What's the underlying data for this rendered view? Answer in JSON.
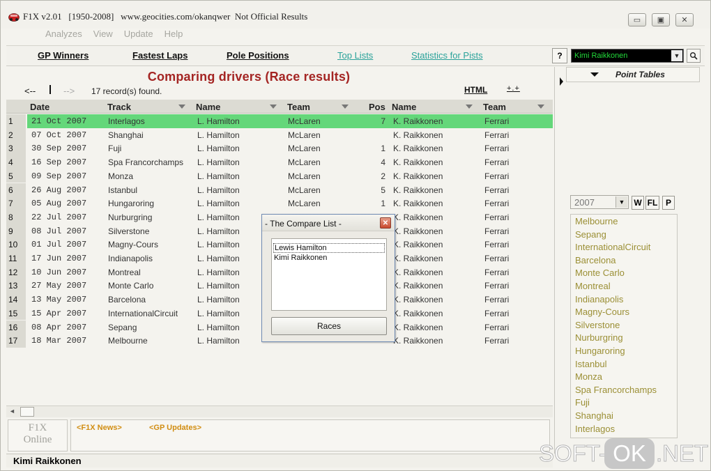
{
  "window": {
    "title": "F1X v2.01   [1950-2008]   www.geocities.com/okanqwer  Not Official Results",
    "controls": {
      "minimize": "▭",
      "maximize": "▣",
      "close": "✕"
    }
  },
  "menu": [
    "Analyzes",
    "View",
    "Update",
    "Help"
  ],
  "nav": {
    "links": [
      "GP Winners",
      "Fastest Laps",
      "Pole Positions"
    ],
    "alt_links": [
      "Top Lists",
      "Statistics for Pists"
    ],
    "help": "?",
    "driver_selected": "Kimi Raikkonen"
  },
  "main": {
    "heading": "Comparing drivers (Race results)",
    "back": "<--",
    "forward": "-->",
    "record_count": "17  record(s) found.",
    "html_link": "HTML",
    "sort_link": "+.+"
  },
  "grid": {
    "columns": [
      "Date",
      "Track",
      "Name",
      "Team",
      "Pos",
      "Name",
      "Team"
    ],
    "rows": [
      {
        "n": "1",
        "date": "21 Oct 2007",
        "track": "Interlagos",
        "name1": "L. Hamilton",
        "team1": "McLaren",
        "pos": "7",
        "name2": "K. Raikkonen",
        "team2": "Ferrari"
      },
      {
        "n": "2",
        "date": "07 Oct 2007",
        "track": "Shanghai",
        "name1": "L. Hamilton",
        "team1": "McLaren",
        "pos": "",
        "name2": "K. Raikkonen",
        "team2": "Ferrari"
      },
      {
        "n": "3",
        "date": "30 Sep 2007",
        "track": "Fuji",
        "name1": "L. Hamilton",
        "team1": "McLaren",
        "pos": "1",
        "name2": "K. Raikkonen",
        "team2": "Ferrari"
      },
      {
        "n": "4",
        "date": "16 Sep 2007",
        "track": "Spa Francorchamps",
        "name1": "L. Hamilton",
        "team1": "McLaren",
        "pos": "4",
        "name2": "K. Raikkonen",
        "team2": "Ferrari"
      },
      {
        "n": "5",
        "date": "09 Sep 2007",
        "track": "Monza",
        "name1": "L. Hamilton",
        "team1": "McLaren",
        "pos": "2",
        "name2": "K. Raikkonen",
        "team2": "Ferrari"
      },
      {
        "n": "6",
        "date": "26 Aug 2007",
        "track": "Istanbul",
        "name1": "L. Hamilton",
        "team1": "McLaren",
        "pos": "5",
        "name2": "K. Raikkonen",
        "team2": "Ferrari"
      },
      {
        "n": "7",
        "date": "05 Aug 2007",
        "track": "Hungaroring",
        "name1": "L. Hamilton",
        "team1": "McLaren",
        "pos": "1",
        "name2": "K. Raikkonen",
        "team2": "Ferrari"
      },
      {
        "n": "8",
        "date": "22 Jul 2007",
        "track": "Nurburgring",
        "name1": "L. Hamilton",
        "team1": "",
        "pos": "",
        "name2": "K. Raikkonen",
        "team2": "Ferrari"
      },
      {
        "n": "9",
        "date": "08 Jul 2007",
        "track": "Silverstone",
        "name1": "L. Hamilton",
        "team1": "",
        "pos": "",
        "name2": "K. Raikkonen",
        "team2": "Ferrari"
      },
      {
        "n": "10",
        "date": "01 Jul 2007",
        "track": "Magny-Cours",
        "name1": "L. Hamilton",
        "team1": "",
        "pos": "",
        "name2": "K. Raikkonen",
        "team2": "Ferrari"
      },
      {
        "n": "11",
        "date": "17 Jun 2007",
        "track": "Indianapolis",
        "name1": "L. Hamilton",
        "team1": "",
        "pos": "",
        "name2": "K. Raikkonen",
        "team2": "Ferrari"
      },
      {
        "n": "12",
        "date": "10 Jun 2007",
        "track": "Montreal",
        "name1": "L. Hamilton",
        "team1": "",
        "pos": "",
        "name2": "K. Raikkonen",
        "team2": "Ferrari"
      },
      {
        "n": "13",
        "date": "27 May 2007",
        "track": "Monte Carlo",
        "name1": "L. Hamilton",
        "team1": "",
        "pos": "",
        "name2": "K. Raikkonen",
        "team2": "Ferrari"
      },
      {
        "n": "14",
        "date": "13 May 2007",
        "track": "Barcelona",
        "name1": "L. Hamilton",
        "team1": "",
        "pos": "",
        "name2": "K. Raikkonen",
        "team2": "Ferrari"
      },
      {
        "n": "15",
        "date": "15 Apr 2007",
        "track": "InternationalCircuit",
        "name1": "L. Hamilton",
        "team1": "",
        "pos": "",
        "name2": "K. Raikkonen",
        "team2": "Ferrari"
      },
      {
        "n": "16",
        "date": "08 Apr 2007",
        "track": "Sepang",
        "name1": "L. Hamilton",
        "team1": "",
        "pos": "",
        "name2": "K. Raikkonen",
        "team2": "Ferrari"
      },
      {
        "n": "17",
        "date": "18 Mar 2007",
        "track": "Melbourne",
        "name1": "L. Hamilton",
        "team1": "",
        "pos": "",
        "name2": "K. Raikkonen",
        "team2": "Ferrari"
      }
    ]
  },
  "footer": {
    "logo_line1": "F1X",
    "logo_line2": "Online",
    "news_links": [
      "<F1X News>",
      "<GP Updates>"
    ],
    "status": "Kimi Raikkonen"
  },
  "sidebar": {
    "point_tables": "Point Tables",
    "year": "2007",
    "year_buttons": [
      "W",
      "FL",
      "P"
    ],
    "tracks": [
      "Melbourne",
      "Sepang",
      "InternationalCircuit",
      "Barcelona",
      "Monte Carlo",
      "Montreal",
      "Indianapolis",
      "Magny-Cours",
      "Silverstone",
      "Nurburgring",
      "Hungaroring",
      "Istanbul",
      "Monza",
      "Spa Francorchamps",
      "Fuji",
      "Shanghai",
      "Interlagos"
    ]
  },
  "dialog": {
    "title": "- The Compare List -",
    "close": "✕",
    "items": [
      "Lewis Hamilton",
      "Kimi Raikkonen"
    ],
    "button": "Races"
  },
  "watermark": {
    "part1": "SOFT-",
    "part2": "OK",
    "part3": ".NET"
  },
  "colors": {
    "selected_row": "#64d77a",
    "heading": "#a42523",
    "alt_link": "#2aa29a",
    "track_list_text": "#9b8f35",
    "news_link": "#d18d12",
    "driver_select_text": "#22d93a"
  }
}
